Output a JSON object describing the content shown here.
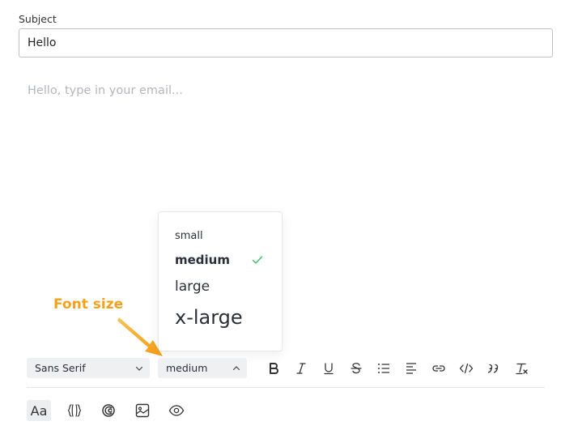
{
  "subject": {
    "label": "Subject",
    "value": "Hello"
  },
  "editor": {
    "placeholder": "Hello, type in your email..."
  },
  "font_size_dropdown": {
    "options": [
      "small",
      "medium",
      "large",
      "x-large"
    ],
    "selected": "medium"
  },
  "callout": {
    "text": "Font size"
  },
  "toolbar": {
    "font_family": "Sans Serif",
    "font_size": "medium",
    "buttons": [
      "bold-icon",
      "italic-icon",
      "underline-icon",
      "strikethrough-icon",
      "bullet-list-icon",
      "align-left-icon",
      "link-icon",
      "code-icon",
      "quote-icon",
      "clear-format-icon"
    ]
  },
  "bottom_bar": {
    "text_format_label": "Aa",
    "buttons": [
      "variables-icon",
      "signature-icon",
      "image-icon",
      "preview-icon"
    ]
  },
  "colors": {
    "accent_callout": "#f5a21b",
    "check": "#39c06b"
  }
}
